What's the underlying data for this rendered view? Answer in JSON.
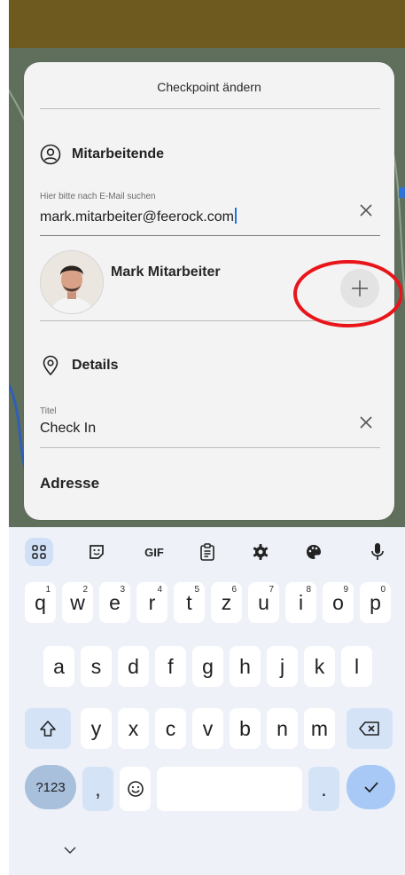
{
  "sheet": {
    "title": "Checkpoint ändern",
    "employees_section": {
      "heading": "Mitarbeitende",
      "search": {
        "placeholder_label": "Hier bitte nach E-Mail suchen",
        "value": "mark.mitarbeiter@feerock.com"
      },
      "result": {
        "name": "Mark Mitarbeiter"
      }
    },
    "details_section": {
      "heading": "Details",
      "title_field": {
        "label": "Titel",
        "value": "Check In"
      }
    },
    "address_heading": "Adresse"
  },
  "keyboard": {
    "toolbar": [
      "apps-grid-icon",
      "sticker-icon",
      "GIF",
      "clipboard-icon",
      "settings-gear-icon",
      "palette-icon",
      "microphone-icon"
    ],
    "row1": [
      {
        "k": "q",
        "n": "1"
      },
      {
        "k": "w",
        "n": "2"
      },
      {
        "k": "e",
        "n": "3"
      },
      {
        "k": "r",
        "n": "4"
      },
      {
        "k": "t",
        "n": "5"
      },
      {
        "k": "z",
        "n": "6"
      },
      {
        "k": "u",
        "n": "7"
      },
      {
        "k": "i",
        "n": "8"
      },
      {
        "k": "o",
        "n": "9"
      },
      {
        "k": "p",
        "n": "0"
      }
    ],
    "row2": [
      "a",
      "s",
      "d",
      "f",
      "g",
      "h",
      "j",
      "k",
      "l"
    ],
    "row3": [
      "y",
      "x",
      "c",
      "v",
      "b",
      "n",
      "m"
    ],
    "symbols_label": "?123",
    "comma": ",",
    "period": "."
  },
  "colors": {
    "accent": "#1a73e8",
    "annotation": "#e8161b"
  }
}
